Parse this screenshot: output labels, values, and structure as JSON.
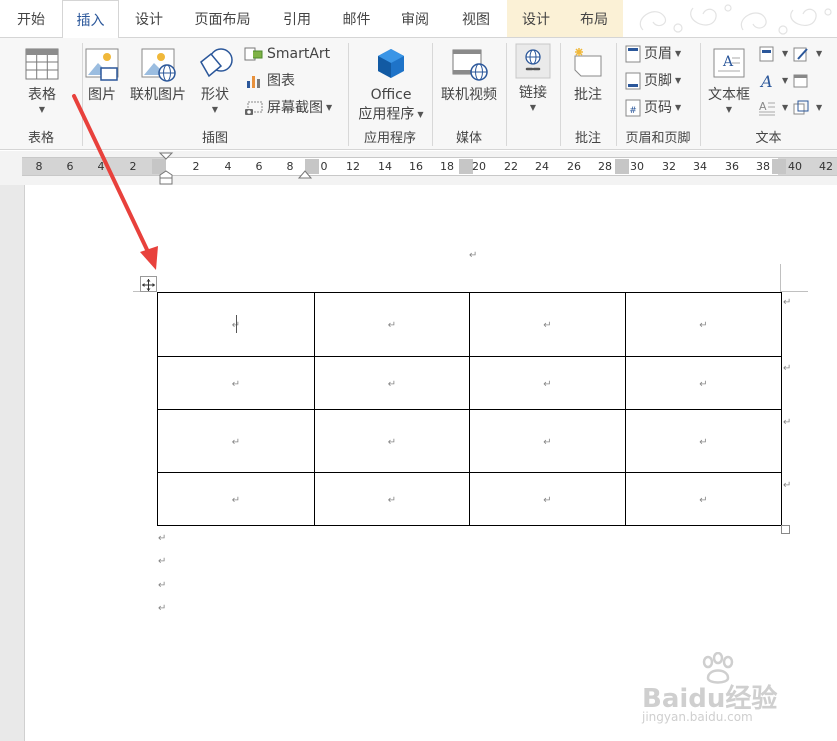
{
  "tabs": [
    "开始",
    "插入",
    "设计",
    "页面布局",
    "引用",
    "邮件",
    "审阅",
    "视图",
    "设计",
    "布局"
  ],
  "ribbon": {
    "groups": {
      "table": "表格",
      "illustrations": "插图",
      "apps": "应用程序",
      "media": "媒体",
      "comments": "批注",
      "header_footer": "页眉和页脚",
      "text": "文本"
    },
    "buttons": {
      "table": "表格",
      "picture": "图片",
      "online_picture": "联机图片",
      "shapes": "形状",
      "smartart": "SmartArt",
      "chart": "图表",
      "screenshot": "屏幕截图",
      "office_apps_line1": "Office",
      "office_apps_line2": "应用程序",
      "online_video": "联机视频",
      "link": "链接",
      "comment": "批注",
      "header": "页眉",
      "footer": "页脚",
      "page_number": "页码",
      "textbox": "文本框"
    }
  },
  "ruler_numbers": [
    "8",
    "6",
    "4",
    "2",
    "2",
    "4",
    "6",
    "8",
    "0",
    "12",
    "14",
    "16",
    "18",
    "20",
    "22",
    "24",
    "26",
    "28",
    "30",
    "32",
    "34",
    "36",
    "38",
    "40",
    "42"
  ],
  "paragraph_mark": "↵",
  "table": {
    "rows": 4,
    "cols": 4
  },
  "watermark": {
    "brand": "Baidu经验",
    "url": "jingyan.baidu.com"
  },
  "colors": {
    "accent": "#2b579a",
    "arrow": "#e8413c",
    "context_tab": "#fbf1d6"
  }
}
